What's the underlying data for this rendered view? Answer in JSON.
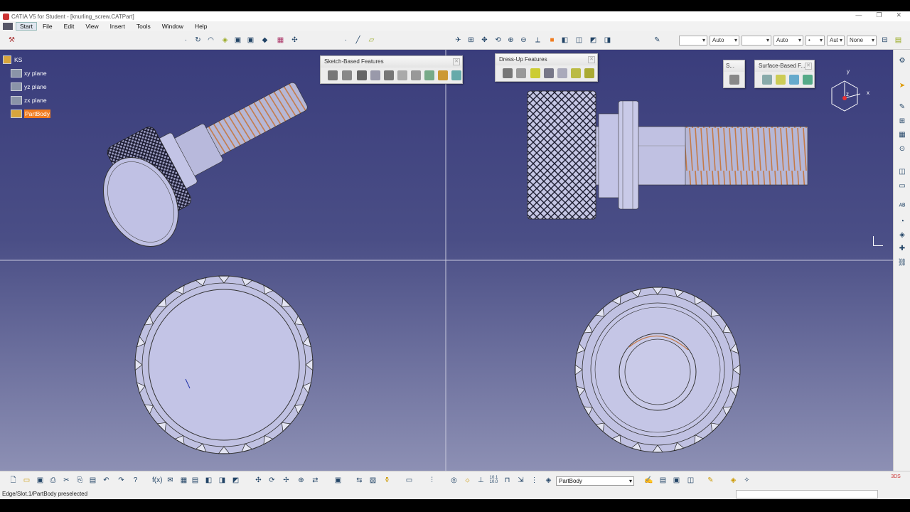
{
  "window": {
    "title": "CATIA V5 for Student - [knurling_screw.CATPart]",
    "minimize": "—",
    "restore": "❐",
    "close": "✕"
  },
  "menu": [
    "Start",
    "File",
    "Edit",
    "View",
    "Insert",
    "Tools",
    "Window",
    "Help"
  ],
  "top_toolbar": {
    "line_type_dd": "",
    "color_dd": "Auto",
    "linestyle_dd": "",
    "thickness_dd": "Auto",
    "point_dd": "•",
    "layer_dd": "Aut",
    "filter_dd": "None"
  },
  "tree": {
    "root": "KS",
    "nodes": [
      "xy plane",
      "yz plane",
      "zx plane",
      "PartBody"
    ]
  },
  "toolbars": {
    "sketch_based": "Sketch-Based Features",
    "dress_up": "Dress-Up Features",
    "s_small": "S...",
    "surface_based": "Surface-Based F..."
  },
  "compass": {
    "x": "x",
    "y": "y",
    "z": "z"
  },
  "bottom_toolbar": {
    "body_select": "PartBody",
    "scale_label": "10.1\n10.0"
  },
  "status": {
    "message": "Edge/Slot.1/PartBody preselected"
  },
  "colors": {
    "selected": "#f07c20",
    "viewport_top": "#3a3d7c",
    "viewport_bottom": "#8d90b4",
    "part_fill": "#b7b8dc"
  }
}
